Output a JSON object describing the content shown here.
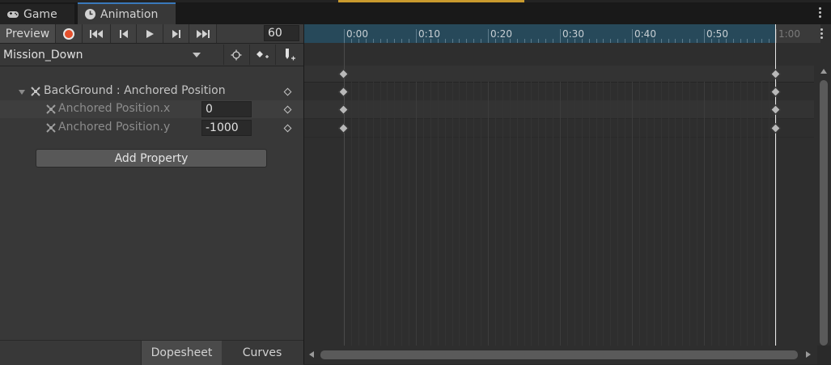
{
  "tabs": {
    "game_label": "Game",
    "animation_label": "Animation"
  },
  "toolbar": {
    "preview_label": "Preview",
    "frame_value": "60"
  },
  "clip": {
    "name": "Mission_Down"
  },
  "properties": [
    {
      "label": "BackGround : Anchored Position",
      "value": ""
    },
    {
      "label": "Anchored Position.x",
      "value": "0"
    },
    {
      "label": "Anchored Position.y",
      "value": "-1000"
    }
  ],
  "add_property_label": "Add Property",
  "bottom_tabs": {
    "dopesheet_label": "Dopesheet",
    "curves_label": "Curves"
  },
  "timeline": {
    "time_labels": [
      "0:00",
      "0:10",
      "0:20",
      "0:30",
      "0:40",
      "0:50",
      "1:00"
    ],
    "playhead_time": "1:00"
  },
  "colors": {
    "accent_tab": "#3a79bb",
    "record_button": "#e5502c",
    "ruler_active": "#27495a"
  },
  "icons": {
    "game_tab": "gamepad-icon",
    "animation_tab": "clock-icon",
    "record": "record-icon",
    "first_key": "first-keyframe-icon",
    "prev_key": "previous-keyframe-icon",
    "play": "play-icon",
    "next_key": "next-keyframe-icon",
    "last_key": "last-keyframe-icon",
    "filter": "filter-icon",
    "add_keyframe": "add-keyframe-icon",
    "add_event": "add-event-icon",
    "more": "kebab-menu-icon"
  }
}
